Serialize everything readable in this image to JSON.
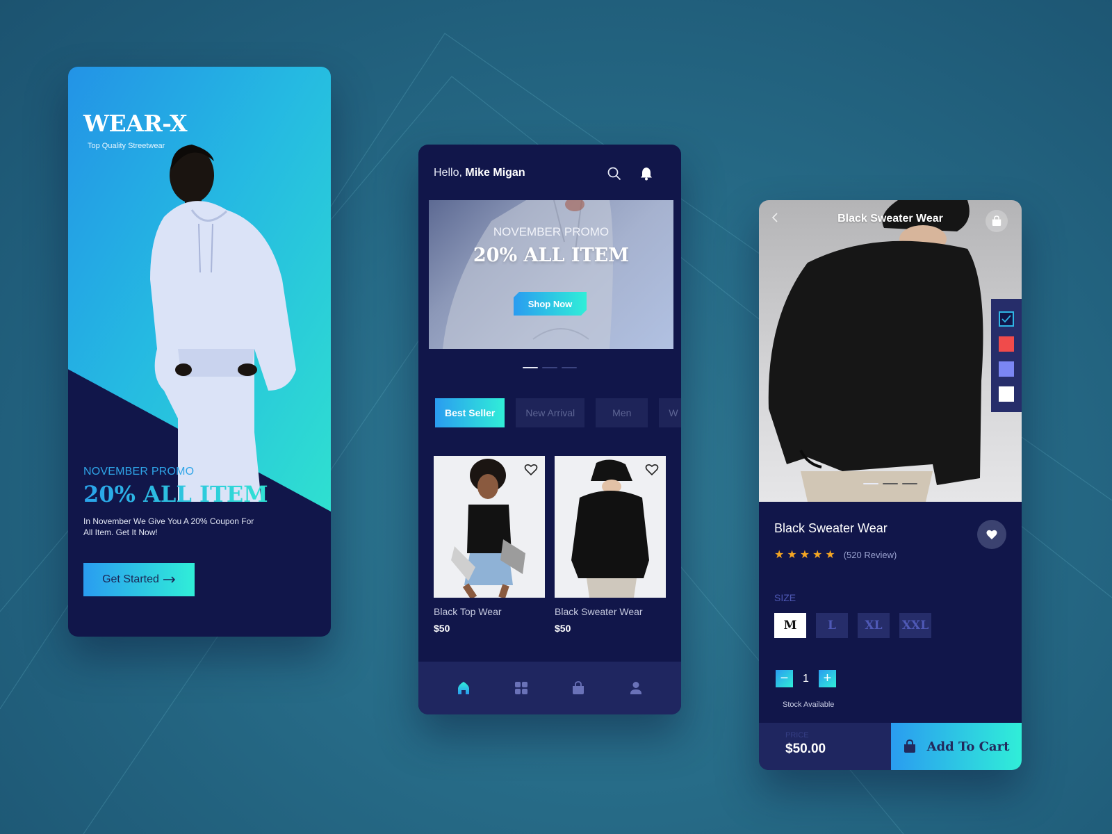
{
  "splash": {
    "brand": "WEAR-X",
    "tagline": "Top Quality Streetwear",
    "promo_label": "NOVEMBER PROMO",
    "promo_title": "20% ALL ITEM",
    "promo_desc": "In November We Give You A 20% Coupon For All Item. Get It Now!",
    "cta_label": "Get Started",
    "cta_icon": "arrow-right-icon"
  },
  "home": {
    "greeting_prefix": "Hello, ",
    "user_name": "Mike Migan",
    "header_icons": [
      "search-icon",
      "bell-icon"
    ],
    "banner": {
      "label": "NOVEMBER PROMO",
      "title": "20% ALL ITEM",
      "button": "Shop Now",
      "slides": 3,
      "active_slide": 1
    },
    "tabs": [
      {
        "label": "Best Seller",
        "active": true
      },
      {
        "label": "New Arrival",
        "active": false
      },
      {
        "label": "Men",
        "active": false
      },
      {
        "label": "W",
        "active": false
      }
    ],
    "products": [
      {
        "name": "Black Top Wear",
        "price": "$50"
      },
      {
        "name": "Black Sweater Wear",
        "price": "$50"
      }
    ],
    "bottom_nav": [
      {
        "icon": "home-icon",
        "active": true
      },
      {
        "icon": "grid-icon",
        "active": false
      },
      {
        "icon": "shopping-bag-icon",
        "active": false
      },
      {
        "icon": "user-icon",
        "active": false
      }
    ]
  },
  "detail": {
    "header_title": "Black Sweater Wear",
    "product_name": "Black Sweater Wear",
    "rating": 5,
    "reviews": "(520 Review)",
    "colors": [
      {
        "hex": "#11164a",
        "selected": true
      },
      {
        "hex": "#f04b4b",
        "selected": false
      },
      {
        "hex": "#7b86f4",
        "selected": false
      },
      {
        "hex": "#ffffff",
        "selected": false
      }
    ],
    "image_slides": 3,
    "active_image": 1,
    "size_label": "SIZE",
    "sizes": [
      {
        "label": "M",
        "active": true
      },
      {
        "label": "L",
        "active": false
      },
      {
        "label": "XL",
        "active": false
      },
      {
        "label": "XXL",
        "active": false
      }
    ],
    "quantity": "1",
    "qty_minus": "−",
    "qty_plus": "+",
    "stock_text": "Stock Available",
    "price_label": "PRICE",
    "price_value": "$50.00",
    "add_to_cart": "Add To Cart"
  },
  "theme": {
    "navy": "#11164a",
    "navy_light": "#1f2660",
    "gradient_start": "#2a9cf0",
    "gradient_end": "#30eed8",
    "star": "#f5a623"
  }
}
